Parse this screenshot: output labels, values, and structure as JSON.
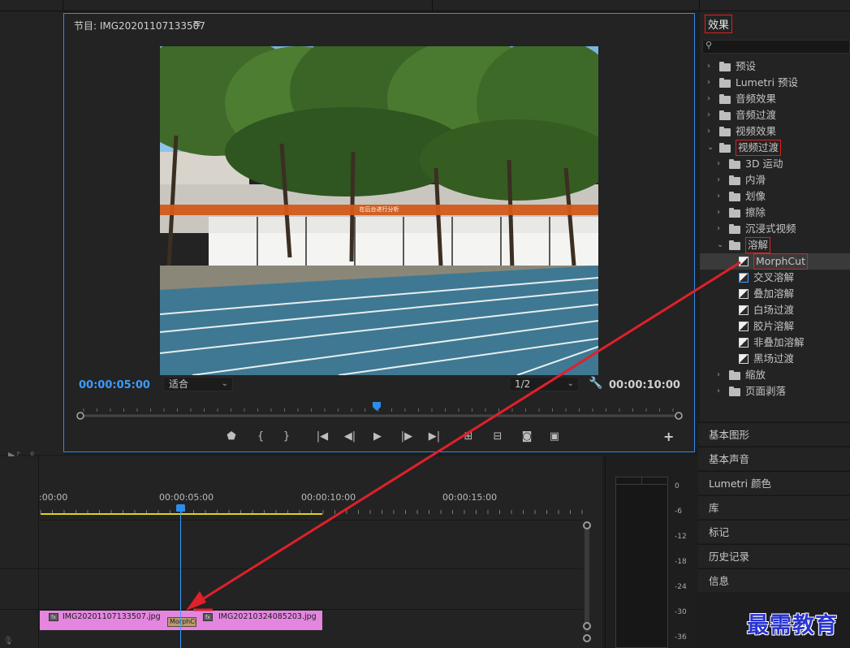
{
  "program_monitor": {
    "title": "节目: IMG20201107133507",
    "menu_icon": "hamburger-icon",
    "banner_text": "在后台进行分析",
    "current_time": "00:00:05:00",
    "zoom": "适合",
    "resolution": "1/2",
    "duration": "00:00:10:00"
  },
  "effects": {
    "tab": "效果",
    "tree": [
      {
        "label": "预设",
        "level": 0,
        "expanded": false,
        "kind": "folder-special"
      },
      {
        "label": "Lumetri 预设",
        "level": 0,
        "expanded": false,
        "kind": "folder-special"
      },
      {
        "label": "音频效果",
        "level": 0,
        "expanded": false,
        "kind": "folder"
      },
      {
        "label": "音频过渡",
        "level": 0,
        "expanded": false,
        "kind": "folder"
      },
      {
        "label": "视频效果",
        "level": 0,
        "expanded": false,
        "kind": "folder"
      },
      {
        "label": "视频过渡",
        "level": 0,
        "expanded": true,
        "kind": "folder",
        "highlight": true
      },
      {
        "label": "3D 运动",
        "level": 1,
        "expanded": false,
        "kind": "folder"
      },
      {
        "label": "内滑",
        "level": 1,
        "expanded": false,
        "kind": "folder"
      },
      {
        "label": "划像",
        "level": 1,
        "expanded": false,
        "kind": "folder"
      },
      {
        "label": "擦除",
        "level": 1,
        "expanded": false,
        "kind": "folder"
      },
      {
        "label": "沉浸式视频",
        "level": 1,
        "expanded": false,
        "kind": "folder"
      },
      {
        "label": "溶解",
        "level": 1,
        "expanded": true,
        "kind": "folder",
        "highlight": true
      },
      {
        "label": "MorphCut",
        "level": 2,
        "kind": "effect",
        "highlight": true,
        "selected": true
      },
      {
        "label": "交叉溶解",
        "level": 2,
        "kind": "effect"
      },
      {
        "label": "叠加溶解",
        "level": 2,
        "kind": "effect"
      },
      {
        "label": "白场过渡",
        "level": 2,
        "kind": "effect"
      },
      {
        "label": "胶片溶解",
        "level": 2,
        "kind": "effect"
      },
      {
        "label": "非叠加溶解",
        "level": 2,
        "kind": "effect"
      },
      {
        "label": "黑场过渡",
        "level": 2,
        "kind": "effect"
      },
      {
        "label": "缩放",
        "level": 1,
        "expanded": false,
        "kind": "folder"
      },
      {
        "label": "页面剥落",
        "level": 1,
        "expanded": false,
        "kind": "folder"
      }
    ]
  },
  "panels": [
    "基本图形",
    "基本声音",
    "Lumetri 颜色",
    "库",
    "标记",
    "历史记录",
    "信息"
  ],
  "timeline": {
    "timecodes": [
      ":00:00",
      "00:00:05:00",
      "00:00:10:00",
      "00:00:15:00"
    ],
    "clips": [
      "IMG20201107133507.jpg",
      "IMG20210324085203.jpg"
    ],
    "transition": "MorphCut"
  },
  "meter": {
    "scale": [
      "0",
      "-6",
      "-12",
      "-18",
      "-24",
      "-30",
      "-36"
    ]
  },
  "watermark": "最需教育",
  "colors": {
    "accent": "#2d8ceb",
    "highlight_box": "#e02020",
    "clip": "#e486e0",
    "work_area": "#e1d21e"
  }
}
